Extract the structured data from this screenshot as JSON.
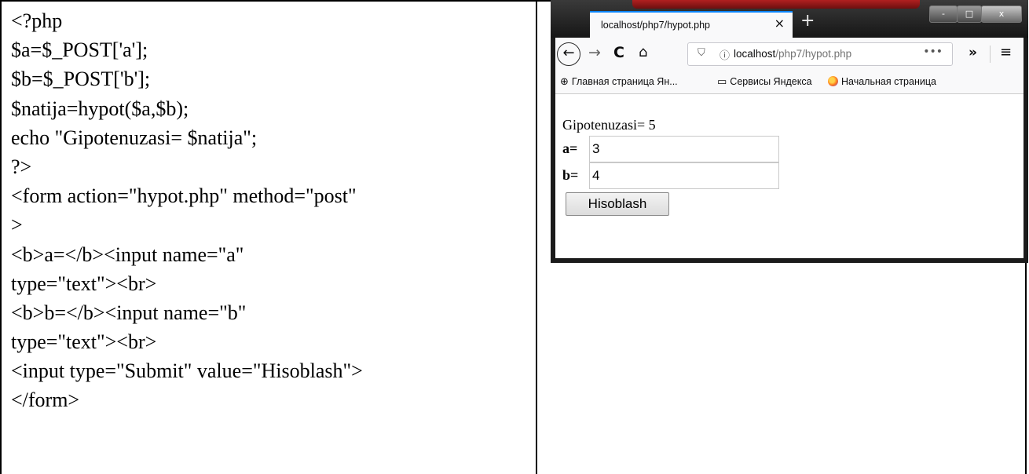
{
  "code_lines": [
    "<?php",
    "$a=$_POST['a'];",
    "$b=$_POST['b'];",
    "$natija=hypot($a,$b);",
    "echo \"Gipotenuzasi= $natija\";",
    "?>",
    "<form action=\"hypot.php\" method=\"post\"",
    ">",
    "<b>a=</b><input name=\"a\"",
    "type=\"text\"><br>",
    "<b>b=</b><input name=\"b\"",
    "type=\"text\"><br>",
    "<input type=\"Submit\" value=\"Hisoblash\">",
    "</form>"
  ],
  "browser": {
    "tab_title": "localhost/php7/hypot.php",
    "tab_close": "×",
    "new_tab": "+",
    "window_controls": {
      "minimize": "-",
      "maximize": "□",
      "close": "x"
    },
    "nav": {
      "back": "←",
      "forward": "→",
      "reload": "C",
      "home": "⌂"
    },
    "url": {
      "host": "localhost",
      "path": "/php7/hypot.php",
      "dots": "•••"
    },
    "overflow": "»",
    "menu": "≡",
    "bookmarks": [
      {
        "label": "Главная страница Ян...",
        "icon": "globe-icon"
      },
      {
        "label": "Сервисы Яндекса",
        "icon": "folder-icon"
      },
      {
        "label": "Начальная страница",
        "icon": "firefox-icon"
      }
    ],
    "page": {
      "result_text": "Gipotenuzasi= 5",
      "label_a": "a=",
      "value_a": "3",
      "label_b": "b=",
      "value_b": "4",
      "submit_label": "Hisoblash"
    }
  }
}
